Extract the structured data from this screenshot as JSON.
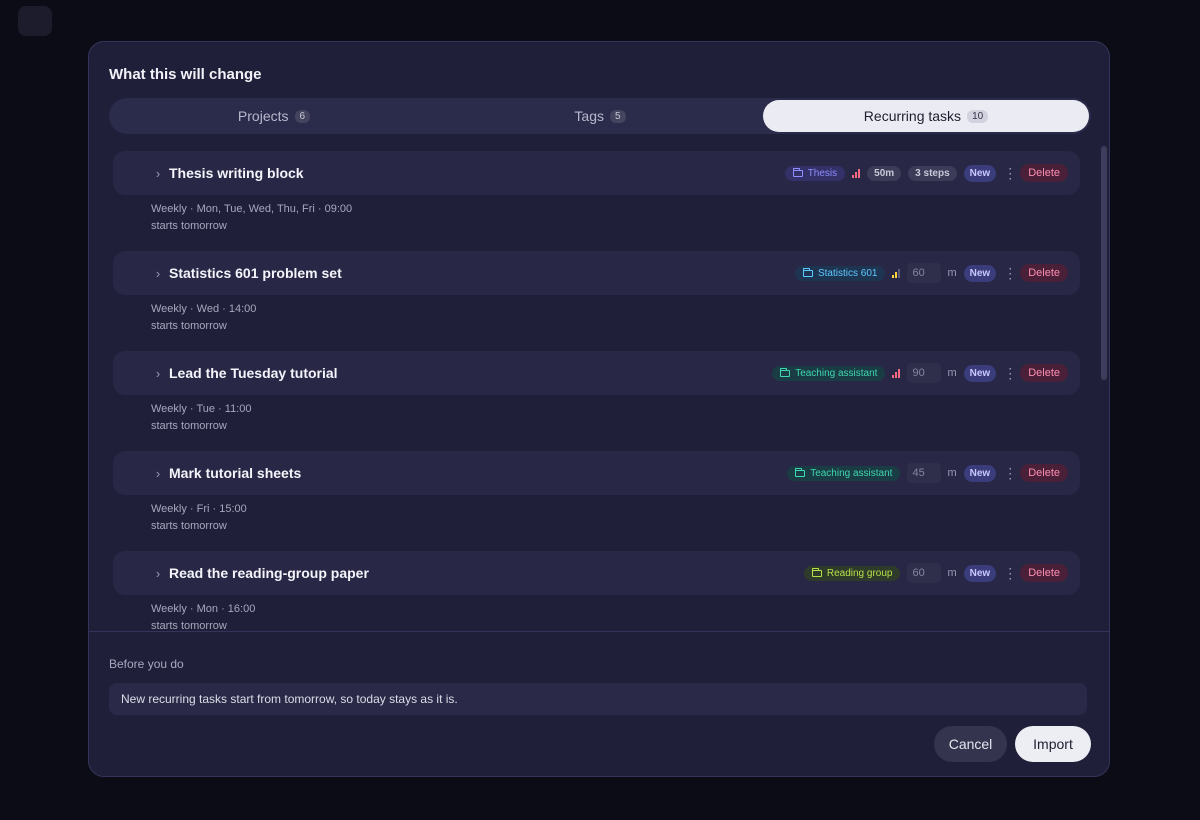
{
  "dialog": {
    "title": "What this will change",
    "tabs": [
      {
        "label": "Projects",
        "count": "6",
        "active": false
      },
      {
        "label": "Tags",
        "count": "5",
        "active": false
      },
      {
        "label": "Recurring tasks",
        "count": "10",
        "active": true
      }
    ],
    "tasks": [
      {
        "title": "Thesis writing block",
        "project": "Thesis",
        "project_color": "#8f8fff",
        "project_bg": "#343068",
        "priority": "high",
        "priority_color": "#ff6b7f",
        "duration_pill": "50m",
        "steps": "3 steps",
        "duration_input": "",
        "duration_unit": "",
        "badge": "New",
        "delete": "Delete",
        "schedule": "Weekly · Mon, Tue, Wed, Thu, Fri · 09:00",
        "starts": "starts tomorrow"
      },
      {
        "title": "Statistics 601 problem set",
        "project": "Statistics 601",
        "project_color": "#5fc8ff",
        "project_bg": "#1e3552",
        "priority": "medium",
        "priority_color": "#ffd23d",
        "duration_pill": "",
        "steps": "",
        "duration_input": "60",
        "duration_unit": "m",
        "badge": "New",
        "delete": "Delete",
        "schedule": "Weekly · Wed · 14:00",
        "starts": "starts tomorrow"
      },
      {
        "title": "Lead the Tuesday tutorial",
        "project": "Teaching assistant",
        "project_color": "#3fd6b0",
        "project_bg": "#1a3c44",
        "priority": "high",
        "priority_color": "#ff6b7f",
        "duration_pill": "",
        "steps": "",
        "duration_input": "90",
        "duration_unit": "m",
        "badge": "New",
        "delete": "Delete",
        "schedule": "Weekly · Tue · 11:00",
        "starts": "starts tomorrow"
      },
      {
        "title": "Mark tutorial sheets",
        "project": "Teaching assistant",
        "project_color": "#3fd6b0",
        "project_bg": "#1a3c44",
        "priority": "",
        "priority_color": "",
        "duration_pill": "",
        "steps": "",
        "duration_input": "45",
        "duration_unit": "m",
        "badge": "New",
        "delete": "Delete",
        "schedule": "Weekly · Fri · 15:00",
        "starts": "starts tomorrow"
      },
      {
        "title": "Read the reading-group paper",
        "project": "Reading group",
        "project_color": "#b6e04a",
        "project_bg": "#2e3a2a",
        "priority": "",
        "priority_color": "",
        "duration_pill": "",
        "steps": "",
        "duration_input": "60",
        "duration_unit": "m",
        "badge": "New",
        "delete": "Delete",
        "schedule": "Weekly · Mon · 16:00",
        "starts": "starts tomorrow"
      }
    ],
    "before_label": "Before you do",
    "note": "New recurring tasks start from tomorrow, so today stays as it is.",
    "cancel_label": "Cancel",
    "import_label": "Import"
  }
}
